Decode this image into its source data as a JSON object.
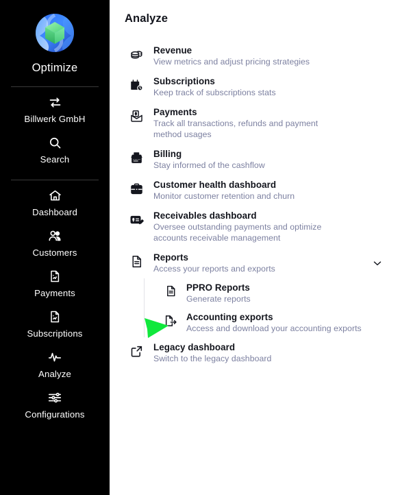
{
  "sidebar": {
    "logo_icon": "optimize-sphere-logo",
    "brand": "Optimize",
    "org": {
      "label": "Billwerk GmbH",
      "icon": "swap-arrows-icon"
    },
    "search": {
      "label": "Search",
      "icon": "search-icon"
    },
    "items": [
      {
        "label": "Dashboard",
        "icon": "home-icon"
      },
      {
        "label": "Customers",
        "icon": "users-icon"
      },
      {
        "label": "Payments",
        "icon": "document-chart-icon"
      },
      {
        "label": "Subscriptions",
        "icon": "document-chart-icon"
      },
      {
        "label": "Analyze",
        "icon": "pulse-icon"
      },
      {
        "label": "Configurations",
        "icon": "sliders-icon"
      }
    ]
  },
  "main": {
    "title": "Analyze",
    "menu": [
      {
        "title": "Revenue",
        "subtitle": "View metrics and adjust pricing strategies",
        "icon": "stacked-coins-icon"
      },
      {
        "title": "Subscriptions",
        "subtitle": "Keep track of subscriptions stats",
        "icon": "calendar-clock-icon"
      },
      {
        "title": "Payments",
        "subtitle": "Track all transactions, refunds and payment method usages",
        "icon": "envelope-dollar-icon"
      },
      {
        "title": "Billing",
        "subtitle": "Stay informed of the cashflow",
        "icon": "cash-register-icon"
      },
      {
        "title": "Customer health dashboard",
        "subtitle": "Monitor customer retention and churn",
        "icon": "briefcase-icon"
      },
      {
        "title": "Receivables dashboard",
        "subtitle": "Oversee outstanding payments and optimize accounts receivable management",
        "icon": "invoice-edit-icon"
      },
      {
        "title": "Reports",
        "subtitle": "Access your reports and exports",
        "icon": "document-icon",
        "expanded": true,
        "chevron": "chevron-down-icon"
      },
      {
        "title": "Legacy dashboard",
        "subtitle": "Switch to the legacy dashboard",
        "icon": "external-link-icon"
      }
    ],
    "submenu": [
      {
        "title": "PPRO Reports",
        "subtitle": "Generate reports",
        "icon": "document-icon"
      },
      {
        "title": "Accounting exports",
        "subtitle": "Access and download your accounting exports",
        "icon": "export-document-icon"
      }
    ]
  },
  "annotation": {
    "type": "arrow",
    "icon": "green-pointer-arrow",
    "color": "#10E83C",
    "points_to": "PPRO Reports"
  },
  "colors": {
    "sidebar_bg": "#000000",
    "main_bg": "#ffffff",
    "title_text": "#13151d",
    "subtitle_text": "#7c80a0",
    "divider": "#3a3a3a",
    "submenu_rail": "#e2e2e8",
    "annotation_green": "#10E83C"
  }
}
